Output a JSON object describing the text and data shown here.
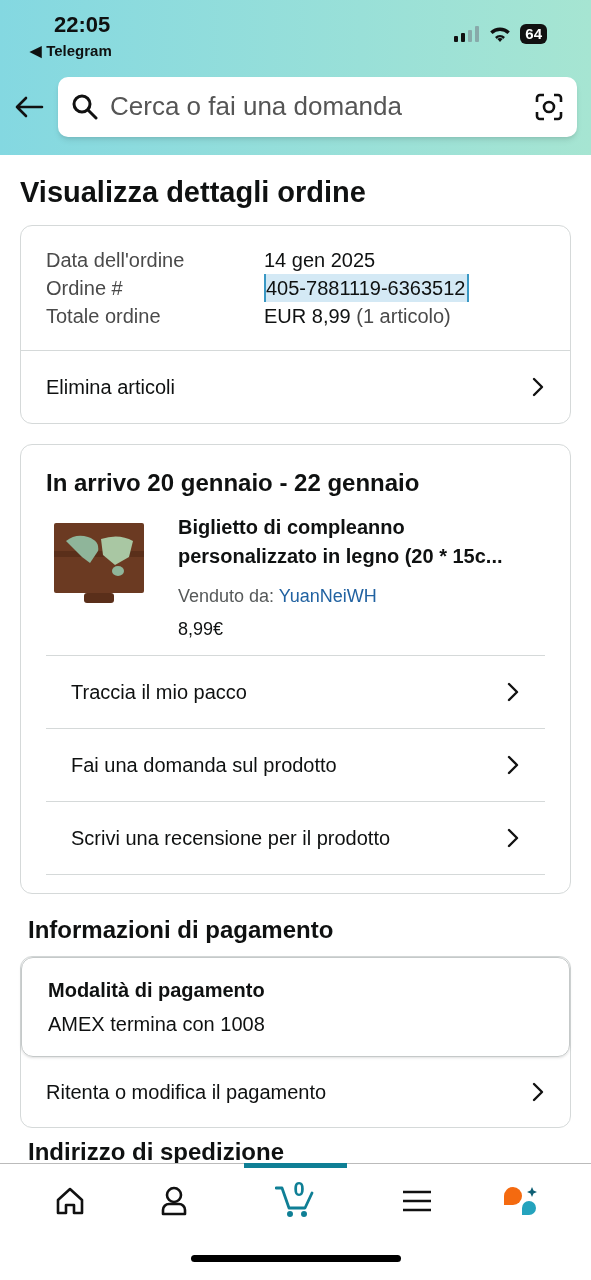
{
  "status_bar": {
    "time": "22:05",
    "back_app": "◀ Telegram",
    "battery": "64"
  },
  "search": {
    "placeholder": "Cerca o fai una domanda"
  },
  "title": "Visualizza dettagli ordine",
  "order_summary": {
    "rows": [
      {
        "label": "Data dell'ordine",
        "value": "14 gen 2025",
        "highlighted": false
      },
      {
        "label": "Ordine #",
        "value": "405-7881119-6363512",
        "highlighted": true
      },
      {
        "label": "Totale ordine",
        "value": "EUR 8,99",
        "note": "(1 articolo)",
        "highlighted": false
      }
    ],
    "action": "Elimina articoli"
  },
  "shipment": {
    "heading": "In arrivo 20 gennaio - 22 gennaio",
    "item": {
      "kind": "picture",
      "title": "Biglietto di compleanno personalizzato in legno (20 * 15c...",
      "seller_label": "Venduto da:",
      "seller": "YuanNeiWH",
      "price": "8,99€"
    },
    "actions": [
      "Traccia il mio pacco",
      "Fai una domanda sul prodotto",
      "Scrivi una recensione per il prodotto"
    ]
  },
  "payment": {
    "heading": "Informazioni di pagamento",
    "method_label": "Modalità di pagamento",
    "method": "AMEX termina con 1008",
    "action": "Ritenta o modifica il pagamento"
  },
  "next_heading": "Indirizzo di spedizione",
  "nav": [
    {
      "kind": "home",
      "selected": false
    },
    {
      "kind": "account",
      "selected": false
    },
    {
      "kind": "cart",
      "selected": true,
      "count": "0"
    },
    {
      "kind": "menu",
      "selected": false
    },
    {
      "kind": "assistant",
      "selected": false
    }
  ]
}
